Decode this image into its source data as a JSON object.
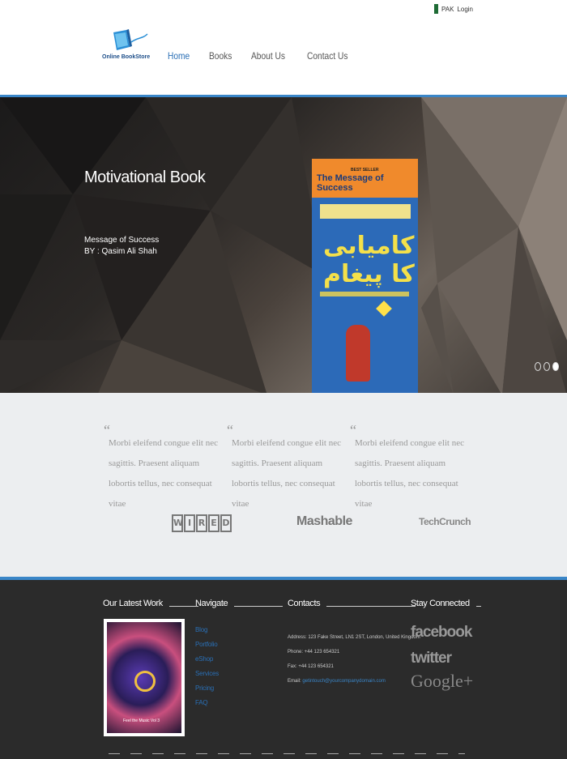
{
  "topbar": {
    "lang": "PAK",
    "login": "Login"
  },
  "brand": {
    "name": "Online BookStore"
  },
  "nav": {
    "items": [
      "Home",
      "Books",
      "About Us",
      "Contact Us"
    ]
  },
  "hero": {
    "title": "Motivational Book",
    "subtitle": "Message of Success",
    "author": "BY : Qasim Ali Shah",
    "book": {
      "badge": "BEST SELLER",
      "title": "The Message of Success",
      "urdu": "کامیابی کا پیغام"
    },
    "slides": 3,
    "active_slide": 3
  },
  "testimonials": [
    "Morbi eleifend congue elit nec sagittis. Praesent aliquam lobortis tellus, nec consequat vitae",
    "Morbi eleifend congue elit nec sagittis. Praesent aliquam lobortis tellus, nec consequat vitae",
    "Morbi eleifend congue elit nec sagittis. Praesent aliquam lobortis tellus, nec consequat vitae"
  ],
  "press_logos": {
    "wired": [
      "W",
      "I",
      "R",
      "E",
      "D"
    ],
    "mashable": "Mashable",
    "techcrunch": "TechCrunch"
  },
  "footer": {
    "latest_work": "Our Latest Work",
    "navigate": "Navigate",
    "contacts": "Contacts",
    "stay_connected": "Stay Connected",
    "work_caption": "Feel the Music Vol 3",
    "nav_links": [
      "Blog",
      "Portfolio",
      "eShop",
      "Services",
      "Pricing",
      "FAQ"
    ],
    "address": "Address: 123 Fake Street, LN1 2ST, London, United Kingdom",
    "phone": "Phone: +44 123 654321",
    "fax": "Fax: +44 123 654321",
    "email_label": "Email: ",
    "email": "getintouch@yourcompanydomain.com",
    "social": {
      "facebook": "facebook",
      "twitter": "twitter",
      "google": "Google+"
    }
  },
  "colors": {
    "accent": "#3a86c8",
    "footer_bg": "#2b2b2b",
    "testimonial_bg": "#eceef0"
  }
}
